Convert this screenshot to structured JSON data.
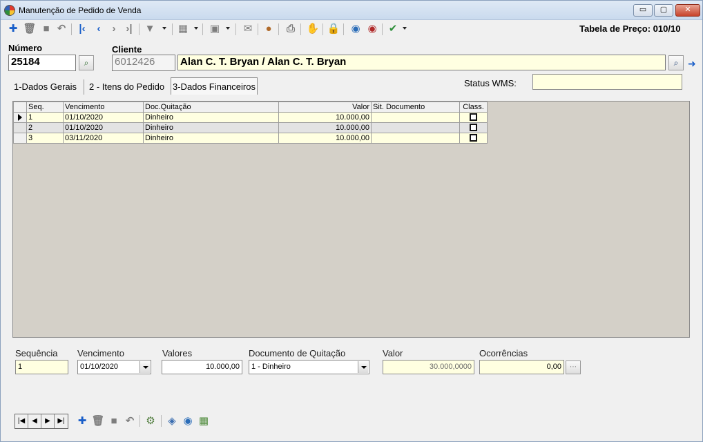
{
  "window": {
    "title": "Manutenção de Pedido de Venda",
    "min_label": "▭",
    "max_label": "▢",
    "close_label": "✕"
  },
  "toolbar": {
    "price_table": "Tabela de Preço: 010/10"
  },
  "header": {
    "numero_label": "Número",
    "numero_value": "25184",
    "cliente_label": "Cliente",
    "cliente_code": "6012426",
    "cliente_name": "Alan C. T. Bryan / Alan C. T. Bryan"
  },
  "tabs": [
    {
      "label": "1-Dados Gerais"
    },
    {
      "label": "2 - Itens do Pedido"
    },
    {
      "label": "3-Dados Financeiros"
    }
  ],
  "status_wms": {
    "label": "Status WMS:",
    "value": ""
  },
  "grid": {
    "columns": [
      "Seq.",
      "Vencimento",
      "Doc.Quitação",
      "Valor",
      "Sit. Documento",
      "Class."
    ],
    "rows": [
      {
        "seq": "1",
        "vencimento": "01/10/2020",
        "doc": "Dinheiro",
        "valor": "10.000,00",
        "sit": ""
      },
      {
        "seq": "2",
        "vencimento": "01/10/2020",
        "doc": "Dinheiro",
        "valor": "10.000,00",
        "sit": ""
      },
      {
        "seq": "3",
        "vencimento": "03/11/2020",
        "doc": "Dinheiro",
        "valor": "10.000,00",
        "sit": ""
      }
    ]
  },
  "details": {
    "sequencia_label": "Sequência",
    "sequencia_value": "1",
    "vencimento_label": "Vencimento",
    "vencimento_value": "01/10/2020",
    "valores_label": "Valores",
    "valores_value": "10.000,00",
    "documento_label": "Documento de Quitação",
    "documento_value": "1 - Dinheiro",
    "valor_label": "Valor",
    "valor_value": "30.000,0000",
    "ocorrencias_label": "Ocorrências",
    "ocorrencias_value": "0,00"
  },
  "colors": {
    "accent": "#1a5fc9",
    "field_yellow": "#ffffe1",
    "grid_background": "#d4d0c8"
  }
}
